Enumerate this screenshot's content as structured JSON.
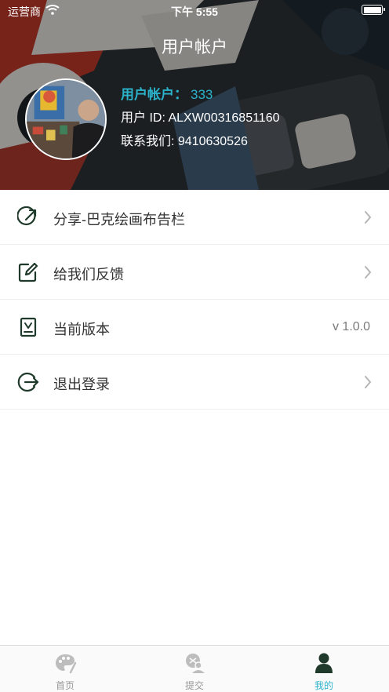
{
  "status_bar": {
    "carrier": "运营商",
    "time": "下午 5:55"
  },
  "header": {
    "title": "用户帐户"
  },
  "profile": {
    "account_label": "用户帐户：",
    "account_value": "333",
    "user_id": "用户 ID: ALXW00316851160",
    "contact": "联系我们: 9410630526"
  },
  "menu": {
    "share": {
      "label": "分享-巴克绘画布告栏"
    },
    "feedback": {
      "label": "给我们反馈"
    },
    "version": {
      "label": "当前版本",
      "value": "v 1.0.0"
    },
    "logout": {
      "label": "退出登录"
    }
  },
  "tabbar": {
    "home": {
      "label": "首页"
    },
    "submit": {
      "label": "提交"
    },
    "mine": {
      "label": "我的"
    }
  },
  "colors": {
    "accent": "#2bb3cc",
    "icon_dark": "#1f3a2a",
    "header_bg": "#24282c"
  }
}
